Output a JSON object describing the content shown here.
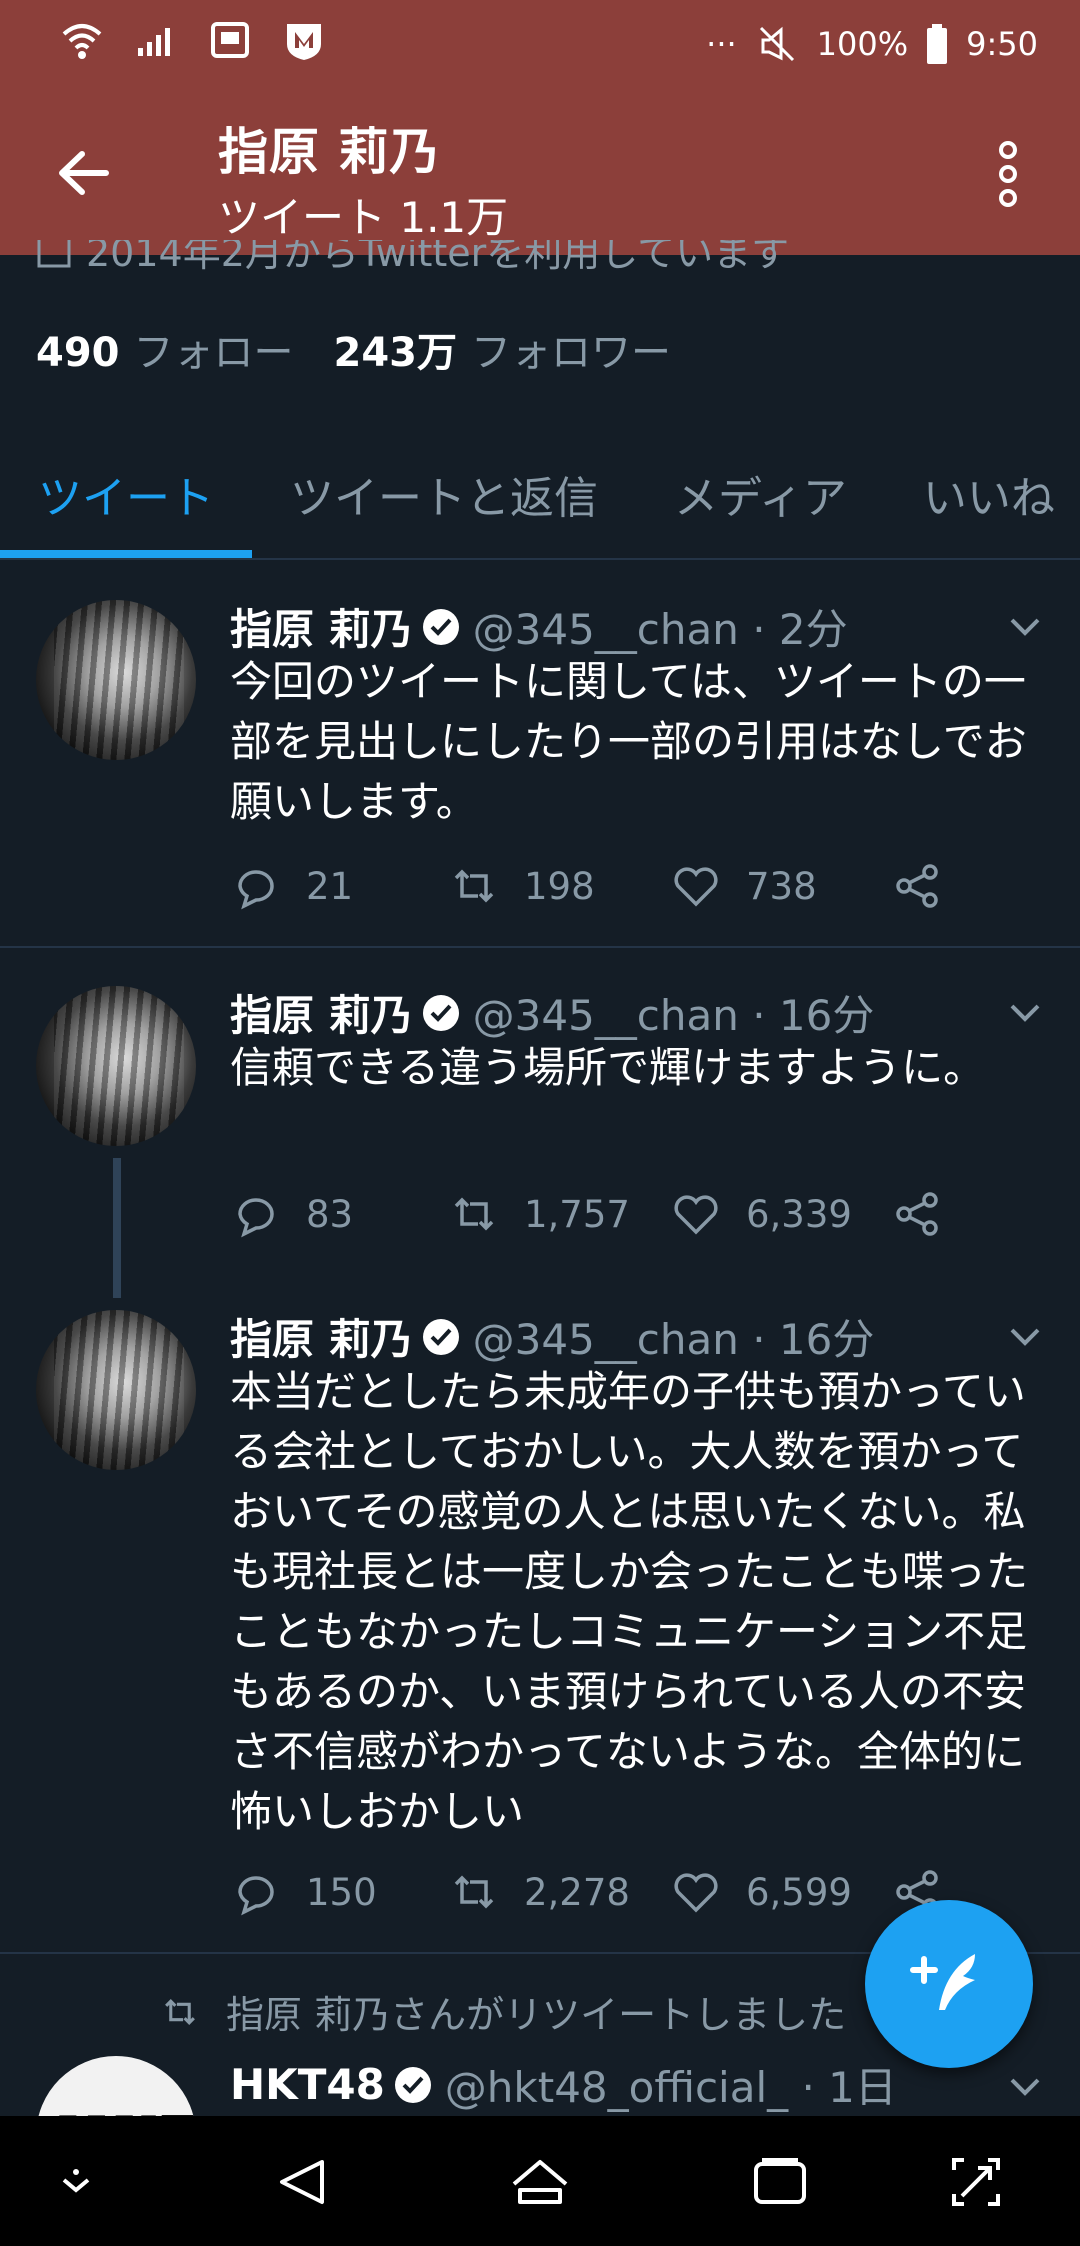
{
  "status_bar": {
    "battery": "100%",
    "time": "9:50",
    "more": "···"
  },
  "app_bar": {
    "title": "指原 莉乃",
    "subtitle": "ツイート 1.1万"
  },
  "profile": {
    "joined": "2014年2月からTwitterを利用しています",
    "following_count": "490",
    "following_label": "フォロー",
    "followers_count": "243万",
    "followers_label": "フォロワー"
  },
  "tabs": [
    {
      "label": "ツイート",
      "active": true
    },
    {
      "label": "ツイートと返信",
      "active": false
    },
    {
      "label": "メディア",
      "active": false
    },
    {
      "label": "いいね",
      "active": false
    }
  ],
  "tweets": [
    {
      "name": "指原 莉乃",
      "handle": "@345__chan · 2分",
      "text": "今回のツイートに関しては、ツイートの一部を見出しにしたり一部の引用はなしでお願いします。",
      "replies": "21",
      "retweets": "198",
      "likes": "738"
    },
    {
      "name": "指原 莉乃",
      "handle": "@345__chan · 16分",
      "text": "信頼できる違う場所で輝けますように。",
      "replies": "83",
      "retweets": "1,757",
      "likes": "6,339"
    },
    {
      "name": "指原 莉乃",
      "handle": "@345__chan · 16分",
      "text": "本当だとしたら未成年の子供も預かっている会社としておかしい。大人数を預かっておいてその感覚の人とは思いたくない。私も現社長とは一度しか会ったことも喋ったこともなかったしコミュニケーション不足もあるのか、いま預けられている人の不安さ不信感がわかってないような。全体的に怖いしおかしい",
      "replies": "150",
      "retweets": "2,278",
      "likes": "6,599"
    },
    {
      "retweet_note": "指原 莉乃さんがリツイートしました",
      "name": "HKT48",
      "handle": "@hkt48_official_ · 1日",
      "avatar_text": "HKT"
    }
  ],
  "icons": {
    "back": "arrow-left-icon",
    "more": "vertical-dots-icon",
    "verified": "verified-badge-icon",
    "reply": "reply-bubble-icon",
    "retweet": "retweet-icon",
    "like": "heart-icon",
    "share": "share-icon",
    "compose": "compose-feather-icon"
  },
  "colors": {
    "app_bar": "#8c3f3a",
    "background": "#141d26",
    "accent": "#1da1f2",
    "muted": "#8899a6"
  }
}
